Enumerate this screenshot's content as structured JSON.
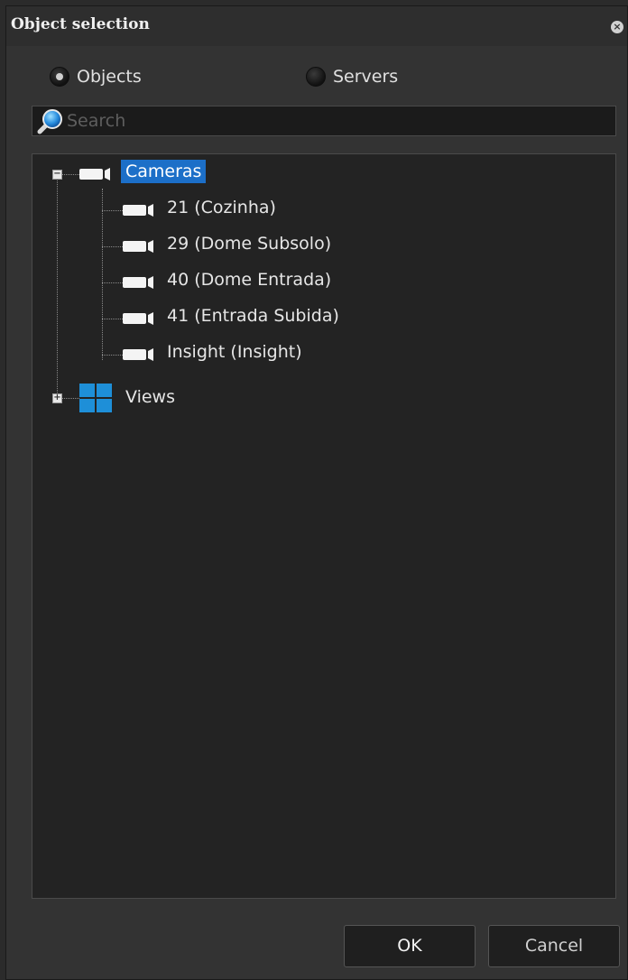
{
  "window": {
    "title": "Object selection",
    "close_glyph": "×"
  },
  "mode": {
    "objects_label": "Objects",
    "servers_label": "Servers",
    "selected": "Objects"
  },
  "search": {
    "placeholder": "Search",
    "value": ""
  },
  "tree": {
    "cameras": {
      "label": "Cameras",
      "expanded": true,
      "selected": true,
      "icon": "camera-icon",
      "expander": "−",
      "children": [
        {
          "label": "21 (Cozinha)",
          "icon": "camera-icon"
        },
        {
          "label": "29 (Dome Subsolo)",
          "icon": "camera-icon"
        },
        {
          "label": "40 (Dome Entrada)",
          "icon": "camera-icon"
        },
        {
          "label": "41 (Entrada Subida)",
          "icon": "camera-icon"
        },
        {
          "label": "Insight (Insight)",
          "icon": "camera-icon"
        }
      ]
    },
    "views": {
      "label": "Views",
      "expanded": false,
      "icon": "views-grid-icon",
      "expander": "+"
    }
  },
  "buttons": {
    "ok_label": "OK",
    "cancel_label": "Cancel"
  },
  "colors": {
    "selection": "#1c6fc8",
    "views_icon": "#1e8fd8",
    "background": "#333333",
    "tree_background": "#232323"
  }
}
